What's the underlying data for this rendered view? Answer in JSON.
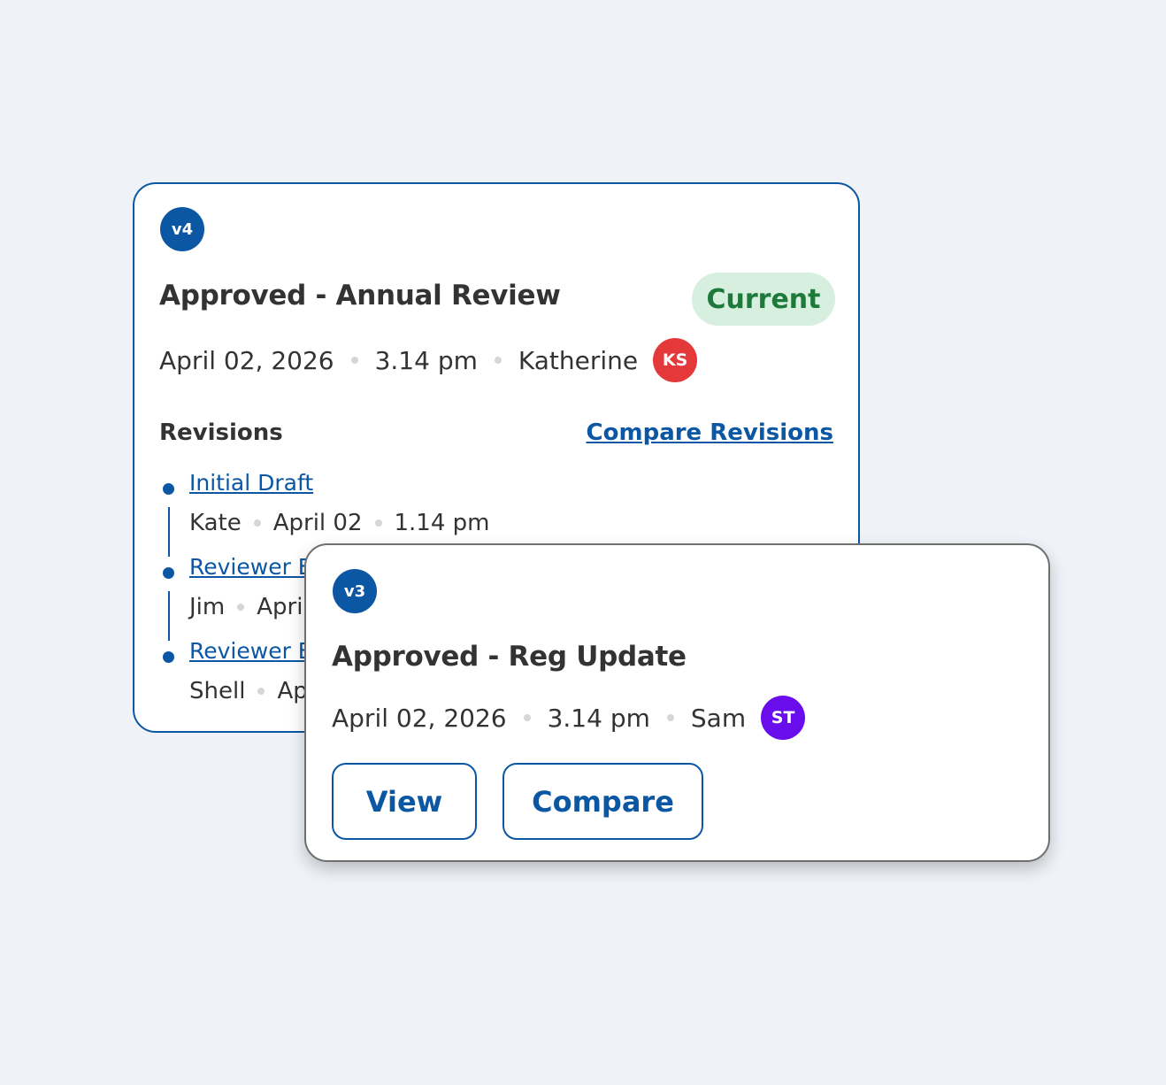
{
  "current_version": {
    "version": "v4",
    "title": "Approved - Annual Review",
    "status": "Current",
    "date": "April 02, 2026",
    "time": "3.14 pm",
    "author": "Katherine",
    "author_initials": "KS",
    "avatar_color": "#e5383b",
    "revisions_label": "Revisions",
    "compare_label": "Compare Revisions",
    "revisions": [
      {
        "title": "Initial Draft",
        "author": "Kate",
        "date": "April 02",
        "time": "1.14 pm"
      },
      {
        "title": "Reviewer E",
        "author": "Jim",
        "date": "Apri",
        "time": ""
      },
      {
        "title": "Reviewer E",
        "author": "Shell",
        "date": "Ap",
        "time": ""
      }
    ]
  },
  "previous_version": {
    "version": "v3",
    "title": "Approved - Reg Update",
    "date": "April 02, 2026",
    "time": "3.14 pm",
    "author": "Sam",
    "author_initials": "ST",
    "avatar_color": "#6a0dec",
    "view_label": "View",
    "compare_label": "Compare"
  },
  "colors": {
    "accent": "#0b57a4",
    "status_bg": "#d6efde",
    "status_text": "#1e7a3a",
    "page_bg": "#eff3f8"
  }
}
